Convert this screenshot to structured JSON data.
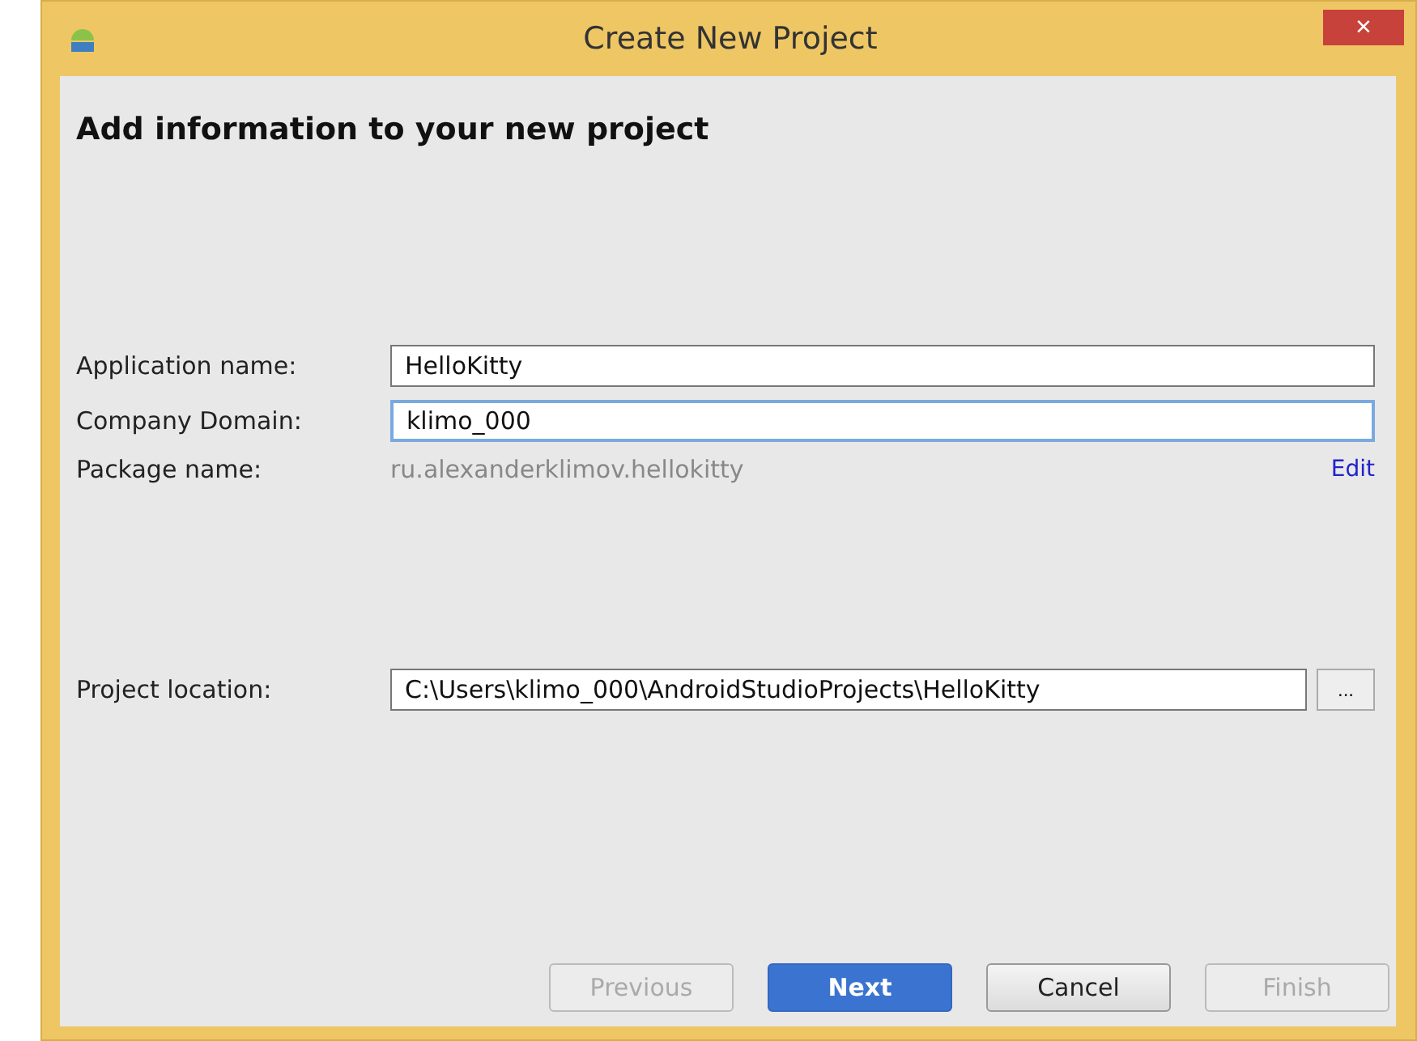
{
  "window": {
    "title": "Create New Project",
    "close": "×"
  },
  "heading": "Add information to your new project",
  "fields": [
    {
      "label": "Application name:",
      "value": "HelloKitty",
      "focused": false
    },
    {
      "label": "Company Domain:",
      "value": "klimo_000",
      "focused": true
    }
  ],
  "package": {
    "label": "Package name:",
    "value": "ru.alexanderklimov.hellokitty",
    "link": "Edit"
  },
  "location": {
    "label": "Project location:",
    "value": "C:\\Users\\klimo_000\\AndroidStudioProjects\\HelloKitty",
    "browse": "..."
  },
  "buttons": [
    {
      "label": "Previous",
      "kind": "normal",
      "disabled": true
    },
    {
      "label": "Next",
      "kind": "default",
      "disabled": false
    },
    {
      "label": "Cancel",
      "kind": "normal",
      "disabled": false
    },
    {
      "label": "Finish",
      "kind": "normal",
      "disabled": true
    }
  ]
}
